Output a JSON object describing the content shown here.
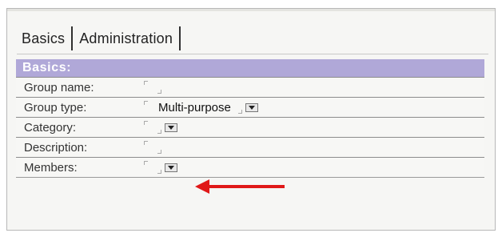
{
  "tabs": [
    {
      "label": "Basics"
    },
    {
      "label": "Administration"
    }
  ],
  "section": {
    "header": "Basics:"
  },
  "fields": [
    {
      "label": "Group name:",
      "value": "",
      "has_dropdown": false
    },
    {
      "label": "Group type:",
      "value": "Multi-purpose",
      "has_dropdown": true
    },
    {
      "label": "Category:",
      "value": "",
      "has_dropdown": true
    },
    {
      "label": "Description:",
      "value": "",
      "has_dropdown": false
    },
    {
      "label": "Members:",
      "value": "",
      "has_dropdown": true
    }
  ],
  "icons": {
    "dropdown": "chevron-down-icon",
    "annotation": "red-arrow-icon"
  },
  "colors": {
    "section_header_bg": "#b0a8d8",
    "arrow": "#e01818"
  }
}
